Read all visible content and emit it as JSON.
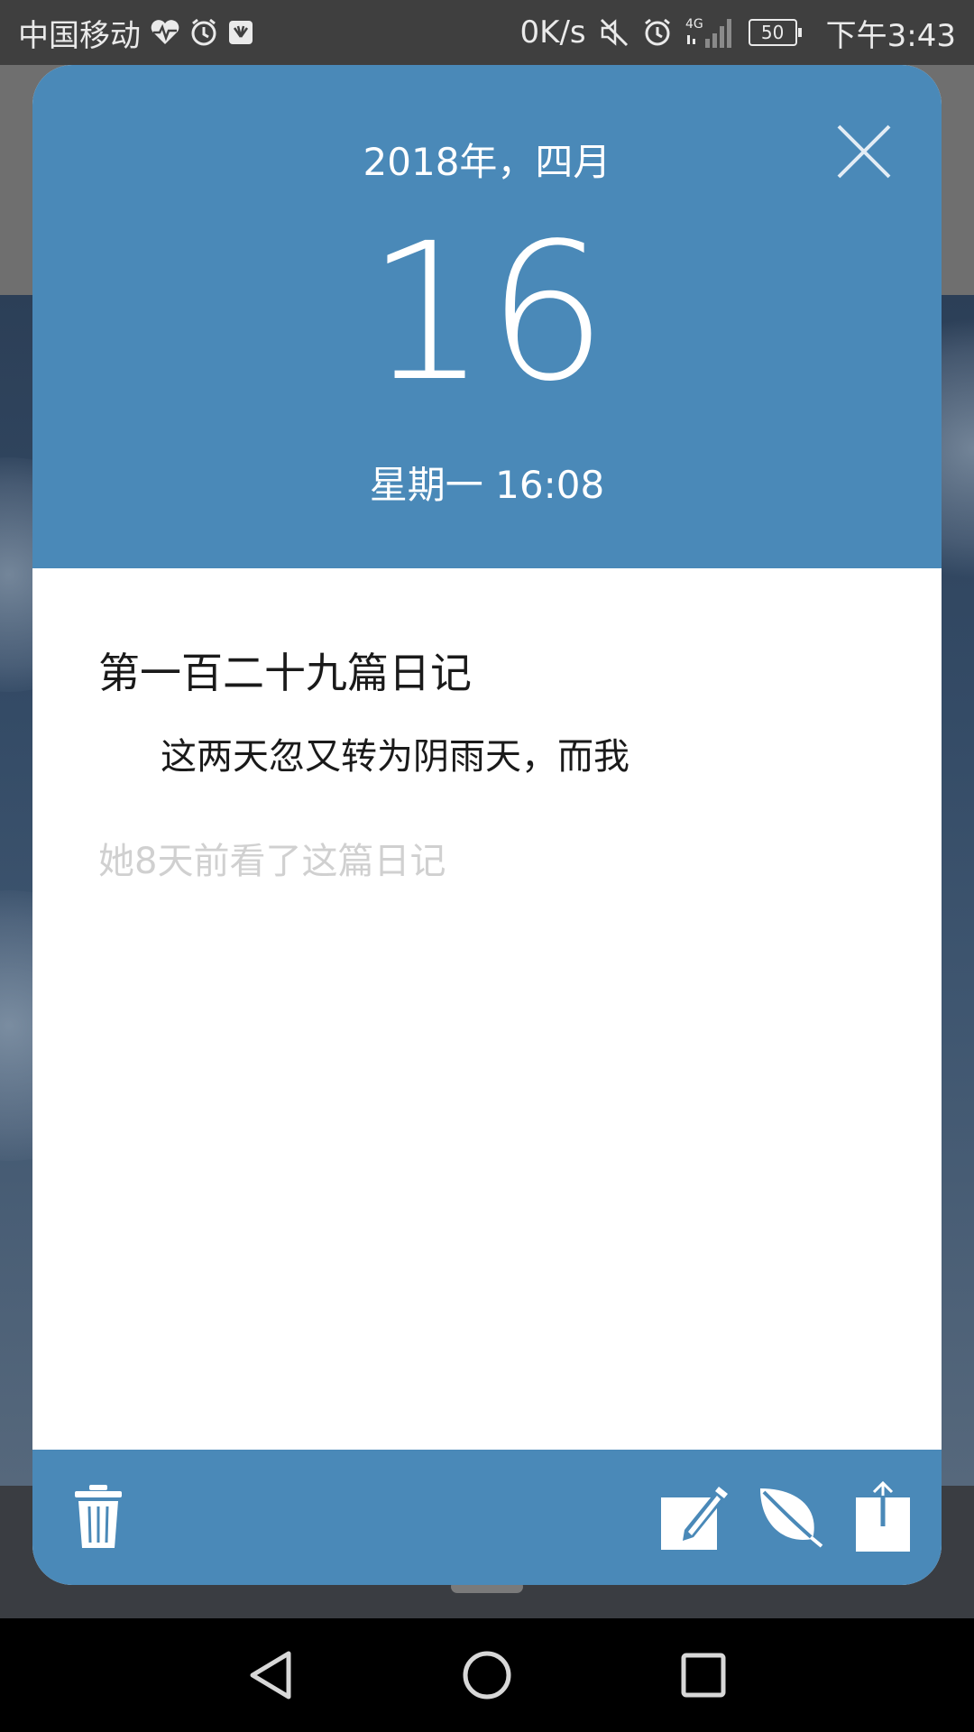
{
  "status_bar": {
    "carrier": "中国移动",
    "net_speed": "0K/s",
    "network_type": "4G",
    "battery_level": "50",
    "time": "下午3:43",
    "left_icons": [
      "heart-rate-icon",
      "alarm-app-icon",
      "huawei-app-icon"
    ],
    "right_icons": [
      "mute-icon",
      "alarm-clock-icon",
      "signal-icon",
      "battery-icon"
    ]
  },
  "diary_card": {
    "month_label": "2018年，四月",
    "day": "16",
    "weekday_time": "星期一 16:08",
    "title": "第一百二十九篇日记",
    "content": "这两天忽又转为阴雨天，而我",
    "read_status": "她8天前看了这篇日记",
    "close_icon": "close-icon",
    "footer_actions": [
      "delete-icon",
      "edit-icon",
      "leaf-icon",
      "share-icon"
    ]
  },
  "nav_bar": {
    "buttons": [
      "back-icon",
      "home-icon",
      "recents-icon"
    ]
  },
  "colors": {
    "header_blue": "#4a89b8",
    "status_bar": "#3f3f3f",
    "read_status_text": "#d0d0d0"
  }
}
